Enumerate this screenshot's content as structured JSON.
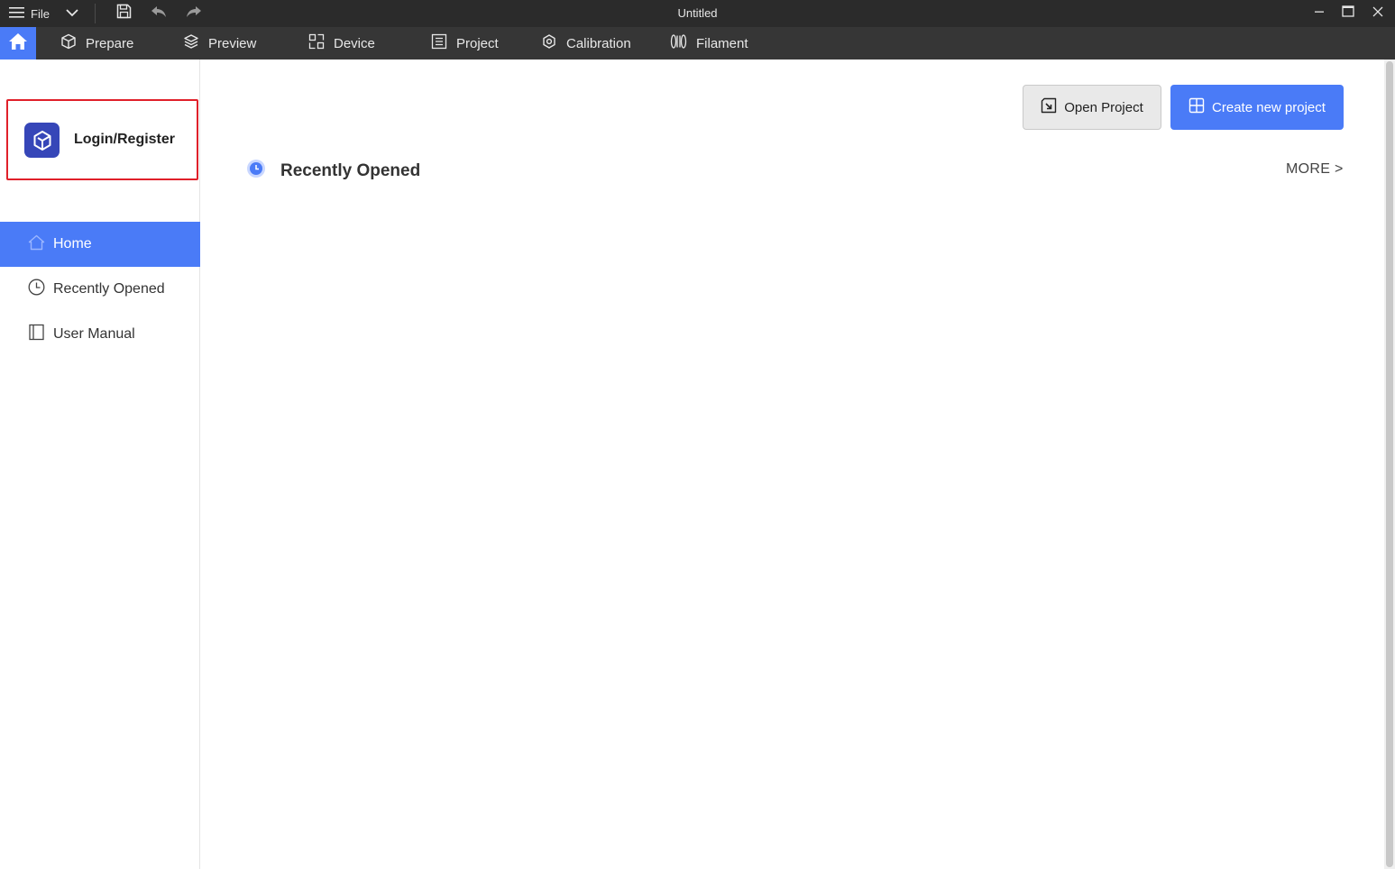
{
  "window": {
    "title": "Untitled",
    "file_menu_label": "File"
  },
  "icons": {
    "menu": "hamburger-icon",
    "dropdown": "chevron-down-icon",
    "save": "save-icon",
    "undo": "undo-icon",
    "redo": "redo-icon",
    "minimize": "minimize-icon",
    "maximize": "maximize-icon",
    "close": "close-icon"
  },
  "tabs": [
    {
      "label": "Prepare",
      "icon": "cube-icon"
    },
    {
      "label": "Preview",
      "icon": "layers-icon"
    },
    {
      "label": "Device",
      "icon": "device-icon"
    },
    {
      "label": "Project",
      "icon": "project-icon"
    },
    {
      "label": "Calibration",
      "icon": "gear-icon"
    },
    {
      "label": "Filament",
      "icon": "filament-icon"
    }
  ],
  "sidebar": {
    "login_label": "Login/Register",
    "items": [
      {
        "label": "Home",
        "icon": "home-icon",
        "active": true
      },
      {
        "label": "Recently Opened",
        "icon": "clock-icon",
        "active": false
      },
      {
        "label": "User Manual",
        "icon": "book-icon",
        "active": false
      }
    ]
  },
  "main": {
    "open_project_label": "Open Project",
    "create_project_label": "Create new project",
    "recent_title": "Recently Opened",
    "more_label": "MORE >"
  },
  "colors": {
    "accent": "#4a7bf7",
    "titlebar": "#2b2b2b",
    "tabbar": "#363636",
    "highlight_border": "#e0202a",
    "logo": "#3646b8"
  }
}
